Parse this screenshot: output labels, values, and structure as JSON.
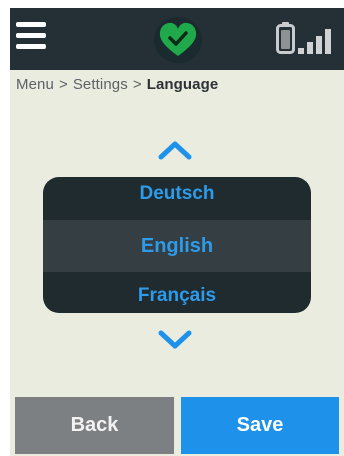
{
  "header": {
    "menu_icon": "hamburger-menu-icon",
    "status_icon": "heart-check-icon",
    "status_color": "#1fa94a",
    "battery_icon": "battery-icon",
    "signal_icon": "signal-bars-icon"
  },
  "breadcrumb": {
    "items": [
      "Menu",
      "Settings"
    ],
    "separator": ">",
    "current": "Language"
  },
  "picker": {
    "up_icon": "chevron-up-icon",
    "down_icon": "chevron-down-icon",
    "options": [
      "Deutsch",
      "English",
      "Français"
    ],
    "selected": "English"
  },
  "footer": {
    "back_label": "Back",
    "save_label": "Save"
  },
  "colors": {
    "background": "#e9ecdf",
    "header": "#243036",
    "accent": "#1e92ea",
    "option_text": "#2e9bea",
    "back_button": "#7d8083"
  }
}
